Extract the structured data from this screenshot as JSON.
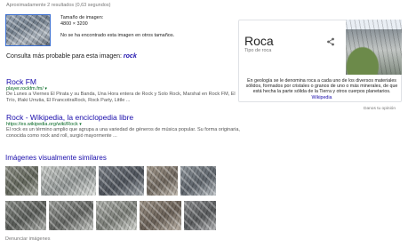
{
  "results_stats": "Aproximadamente 2 resultados (0,63 segundos)",
  "query_image": {
    "size_label": "Tamaño de imagen:",
    "size_value": "4800 × 3200",
    "not_found": "No se ha encontrado esta imagen en otros tamaños."
  },
  "best_guess": {
    "label": "Consulta más probable para esta imagen:",
    "query": "rock"
  },
  "results": [
    {
      "title": "Rock FM",
      "url": "player.rockfm.fm/",
      "caret": "▾",
      "snippet": "De Lunes a Viernes El Pirata y su Banda, Una Hora entera de Rock y Solo Rock, Marshal en Rock FM, El Trío, Iñaki Urrutia, El FrancotiraRock, Rock Party, Little ..."
    },
    {
      "title": "Rock - Wikipedia, la enciclopedia libre",
      "url": "https://es.wikipedia.org/wiki/Rock",
      "caret": "▾",
      "snippet": "El rock es un término amplio que agrupa a una variedad de géneros de música popular. Su forma originaria, conocida como rock and roll, surgió mayormente ..."
    }
  ],
  "similar_images": {
    "title": "Imágenes visualmente similares",
    "report": "Denunciar imágenes"
  },
  "knowledge_panel": {
    "title": "Roca",
    "subtitle": "Tipo de roca",
    "description": "En geología se le denomina roca a cada uno de los diversos materiales sólidos, formados por cristales o granos de uno o más minerales, de que está hecha la parte sólida de la Tierra y otros cuerpos planetarios.",
    "source_link": "Wikipedia",
    "share_icon": "share-icon",
    "feedback": "Danos tu opinión"
  },
  "colors": {
    "link": "#1a0dab",
    "url_green": "#006621",
    "snippet_gray": "#545454",
    "stats_gray": "#777777",
    "query_border": "#3b6fd0"
  }
}
